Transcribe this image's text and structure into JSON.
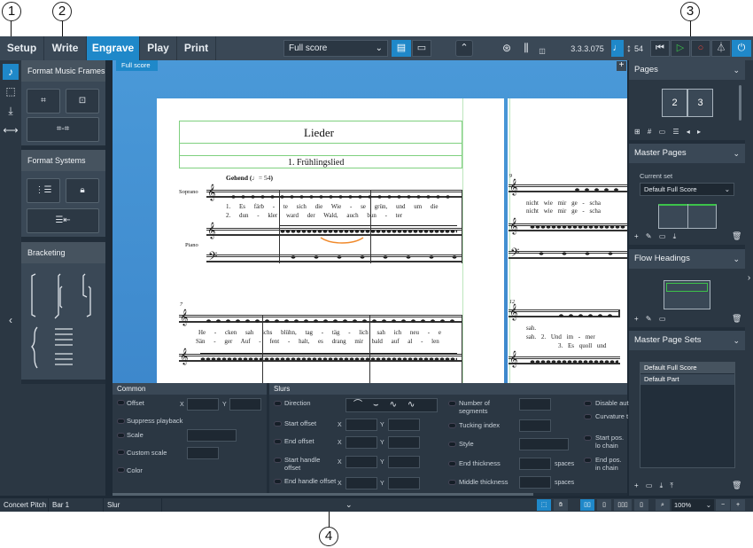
{
  "callouts": [
    "1",
    "2",
    "3",
    "4"
  ],
  "toolbar": {
    "modes": [
      "Setup",
      "Write",
      "Engrave",
      "Play",
      "Print"
    ],
    "active_mode": "Engrave",
    "layout_select": "Full score",
    "timecode": "3.3.3.075",
    "spacing_value": "54"
  },
  "score_tab": "Full score",
  "left_panel": {
    "format_music_frames": "Format Music Frames",
    "format_systems": "Format Systems",
    "bracketing": "Bracketing"
  },
  "score": {
    "title": "Lieder",
    "subtitle": "1. Frühlingslied",
    "tempo_text": "Gehend",
    "tempo_value": "♩= 54",
    "instrument_soprano": "Soprano",
    "instrument_piano": "Piano",
    "system1_lyrics_1": "1. Es färb - te sich die Wie - se grün, und um die",
    "system1_lyrics_2": "2. dun - kler ward der Wald, auch bun - ter",
    "system2_lyrics_1": "He - cken sah ichs blühn, tag - täg - lich sah ich neu - e",
    "system2_lyrics_2": "Sän - ger Auf - fent - halt, es drang mir bald auf al - len",
    "bar_number_9": "9",
    "bar_number_7": "7",
    "bar_number_12": "12",
    "right_lyrics_1": "nicht wie mir ge - scha",
    "right_lyrics_2": "nicht wie mir ge - scha",
    "right_lyrics_3": "sah.",
    "right_lyrics_4": "sah. 2. Und im - mer",
    "right_lyrics_5": "3. Es quoll und"
  },
  "properties": {
    "common": {
      "title": "Common",
      "offset": "Offset",
      "suppress_playback": "Suppress playback",
      "scale": "Scale",
      "custom_scale": "Custom scale",
      "color": "Color",
      "x": "X",
      "y": "Y"
    },
    "slurs": {
      "title": "Slurs",
      "direction": "Direction",
      "start_offset": "Start offset",
      "end_offset": "End offset",
      "start_handle_offset": "Start handle offset",
      "end_handle_offset": "End handle offset",
      "number_of_segments": "Number of segments",
      "tucking_index": "Tucking index",
      "style": "Style",
      "end_thickness": "End thickness",
      "middle_thickness": "Middle thickness",
      "spaces": "spaces",
      "disable_auto": "Disable aut",
      "curvature": "Curvature t",
      "start_pos": "Start pos. lo chain",
      "end_pos": "End pos. in chain"
    }
  },
  "right_panel": {
    "pages_title": "Pages",
    "page_2": "2",
    "page_3": "3",
    "master_pages_title": "Master Pages",
    "current_set_label": "Current set",
    "current_set_value": "Default Full Score",
    "flow_headings_title": "Flow Headings",
    "master_page_sets_title": "Master Page Sets",
    "set_items": [
      "Default Full Score",
      "Default Part"
    ]
  },
  "status_bar": {
    "concert_pitch": "Concert Pitch",
    "bar": "Bar 1",
    "selection": "Slur",
    "zoom": "100%"
  },
  "colors": {
    "accent": "#1f88c9",
    "frame_green": "#7fd07f",
    "panel_bg": "#2b3743"
  }
}
